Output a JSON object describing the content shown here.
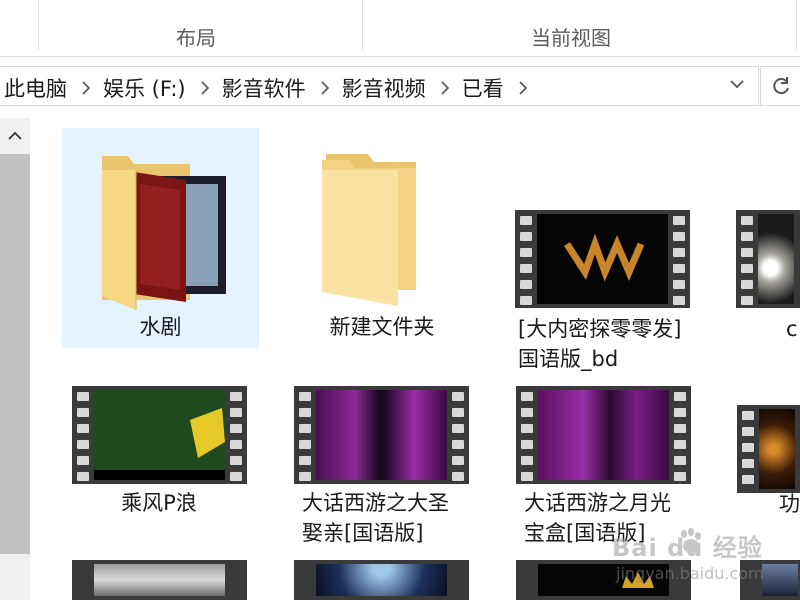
{
  "ribbon": {
    "layout_label": "布局",
    "current_view_label": "当前视图"
  },
  "address": {
    "crumbs": [
      "此电脑",
      "娱乐 (F:)",
      "影音软件",
      "影音视频",
      "已看"
    ]
  },
  "items": [
    {
      "name": "水剧",
      "kind": "folder-with-content",
      "selected": true
    },
    {
      "name": "新建文件夹",
      "kind": "folder"
    },
    {
      "line1": "[大内密探零零发]",
      "line2": "国语版_bd",
      "kind": "video"
    },
    {
      "name": "c",
      "kind": "video"
    },
    {
      "name": "乘风P浪",
      "kind": "video"
    },
    {
      "line1": "大话西游之大圣",
      "line2": "娶亲[国语版]",
      "kind": "video"
    },
    {
      "line1": "大话西游之月光",
      "line2": "宝盒[国语版]",
      "kind": "video"
    },
    {
      "name": "功",
      "kind": "video"
    }
  ],
  "watermark": {
    "brand": "Bai du 经验",
    "url": "jingyan.baidu.com"
  },
  "colors": {
    "selection": "#e5f3ff",
    "folder": "#f7dc8c",
    "film": "#3a3a3a"
  }
}
